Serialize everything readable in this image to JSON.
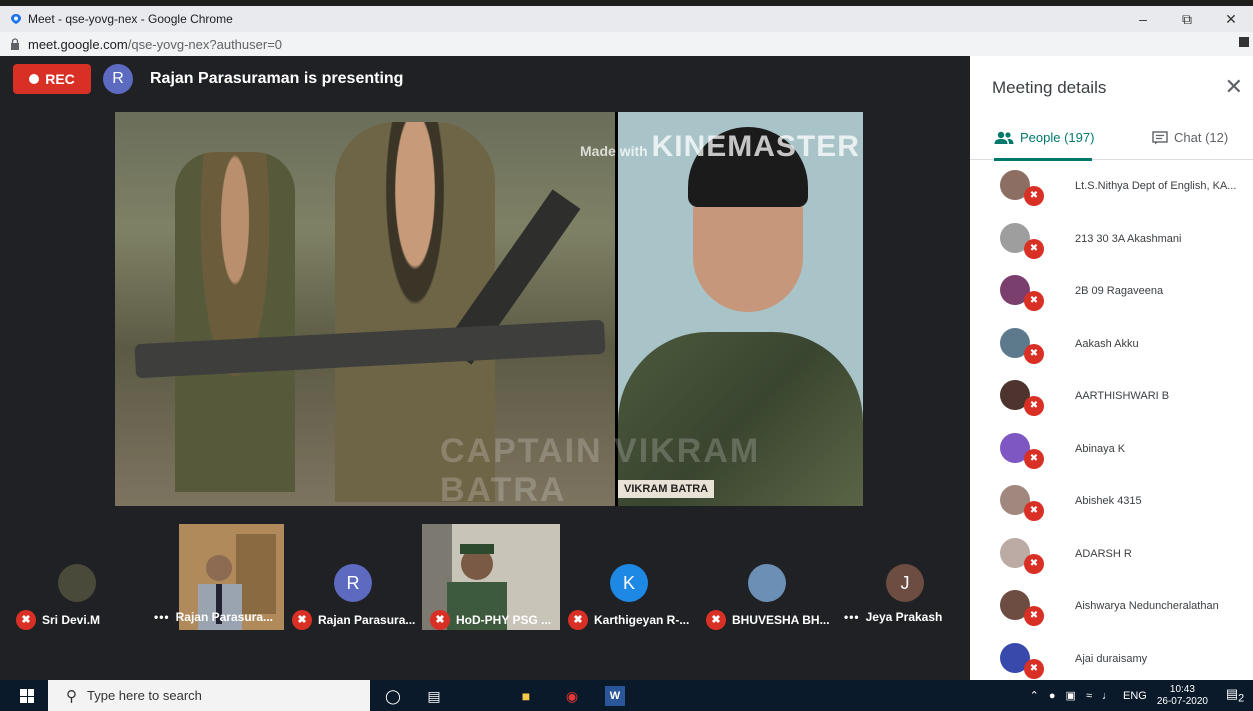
{
  "browser": {
    "tab_title": "Meet - qse-yovg-nex - Google Chrome",
    "url_domain": "meet.google.com",
    "url_path": "/qse-yovg-nex?authuser=0",
    "minimize": "–",
    "restore": "⧉",
    "close": "✕"
  },
  "stage": {
    "rec_label": "REC",
    "presenter_initial": "R",
    "presenting_text": "Rajan Parasuraman is presenting",
    "watermark_prefix": "Made with",
    "watermark_brand": "KINEMASTER",
    "ghost_text": "CAPTAIN VIKRAM BATRA",
    "photo_label": "VIKRAM BATRA"
  },
  "tiles": [
    {
      "name": "Sri Devi.M",
      "initial": "",
      "color": "#4a4a3a",
      "muted": true
    },
    {
      "name": "Rajan Parasura...",
      "initial": "",
      "color": "",
      "muted": false,
      "video": true
    },
    {
      "name": "Rajan Parasura...",
      "initial": "R",
      "color": "#5c6bc0",
      "muted": true
    },
    {
      "name": "HoD-PHY PSG ...",
      "initial": "",
      "color": "",
      "muted": true,
      "video": true
    },
    {
      "name": "Karthigeyan R-...",
      "initial": "K",
      "color": "#1e88e5",
      "muted": true
    },
    {
      "name": "BHUVESHA BH...",
      "initial": "",
      "color": "#6b8fb5",
      "muted": true
    },
    {
      "name": "Jeya Prakash",
      "initial": "J",
      "color": "#6d4c41",
      "muted": false
    }
  ],
  "panel": {
    "title": "Meeting details",
    "close": "✕",
    "people_tab": "People (197)",
    "chat_tab": "Chat (12)",
    "people": [
      {
        "name": "Lt.S.Nithya Dept of English, KA...",
        "color": "#8d6e63"
      },
      {
        "name": "213 30 3A Akashmani",
        "color": "#9e9e9e"
      },
      {
        "name": "2B 09 Ragaveena",
        "color": "#7b3f6e"
      },
      {
        "name": "Aakash Akku",
        "color": "#5d7a8c"
      },
      {
        "name": "AARTHISHWARI B",
        "color": "#4e342e"
      },
      {
        "name": "Abinaya K",
        "color": "#7e57c2"
      },
      {
        "name": "Abishek 4315",
        "color": "#a1887f"
      },
      {
        "name": "ADARSH R",
        "color": "#bcaaa4"
      },
      {
        "name": "Aishwarya Neduncheralathan",
        "color": "#6d4c41"
      },
      {
        "name": "Ajai duraisamy",
        "color": "#3949ab"
      }
    ]
  },
  "taskbar": {
    "search_placeholder": "Type here to search",
    "language": "ENG",
    "time": "10:43",
    "date": "26-07-2020",
    "notif_count": "2"
  }
}
